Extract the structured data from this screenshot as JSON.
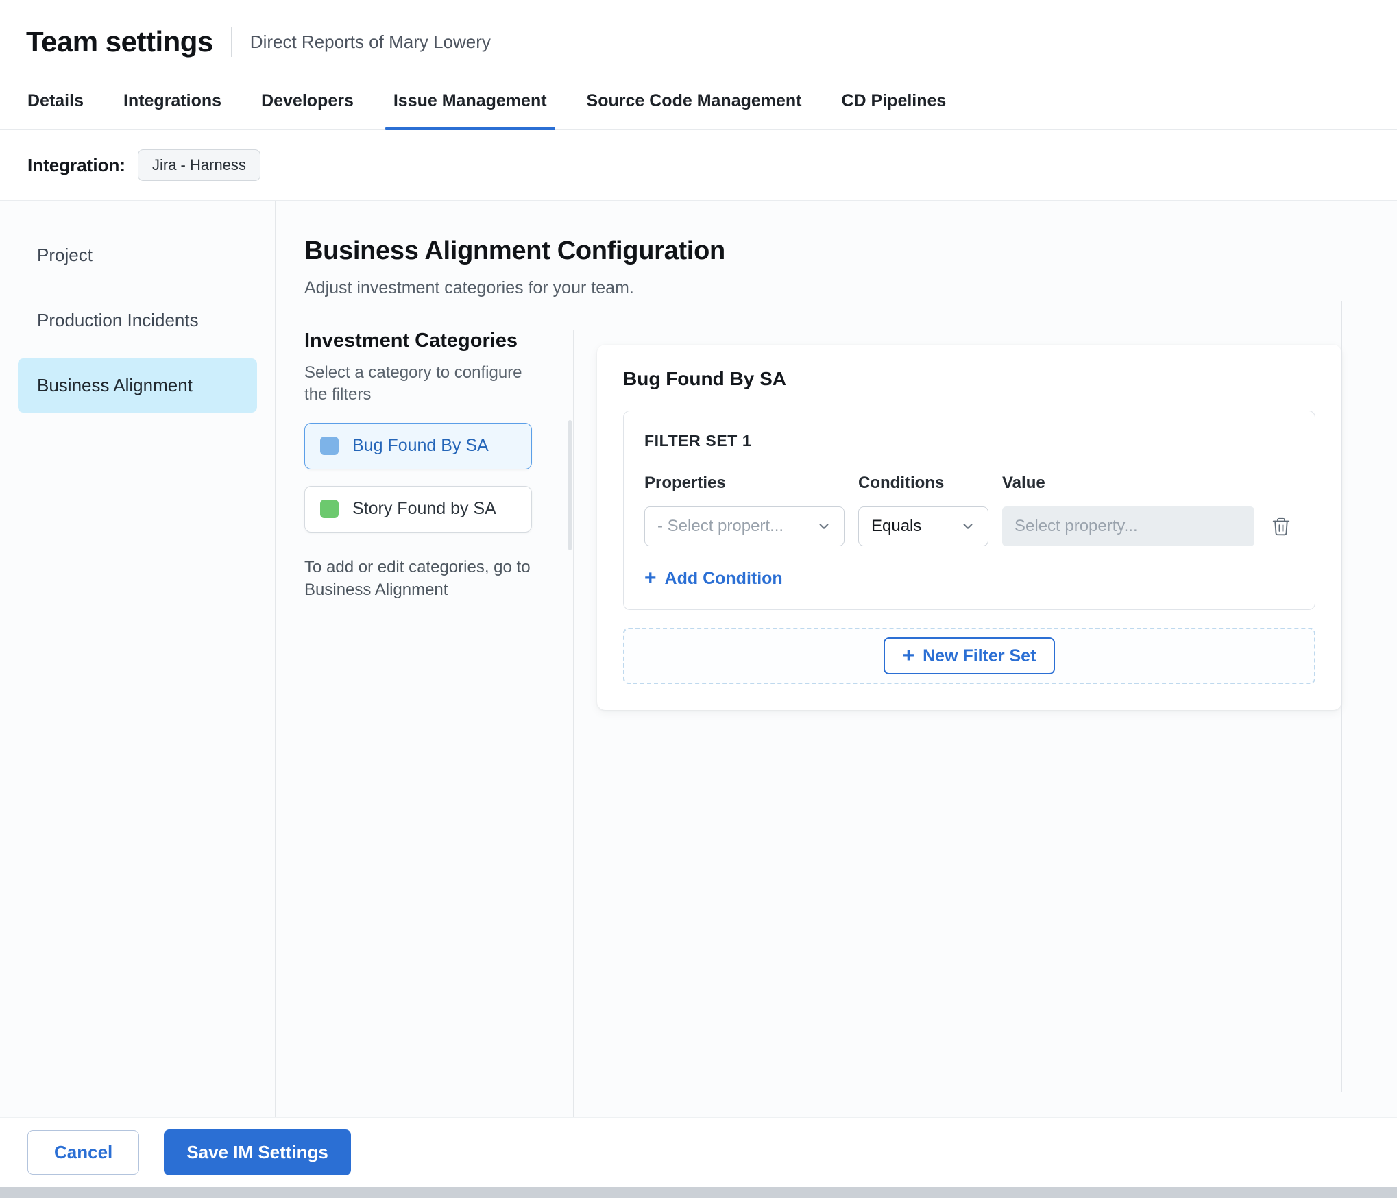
{
  "header": {
    "title": "Team settings",
    "subtitle": "Direct Reports of Mary Lowery"
  },
  "tabs": [
    {
      "label": "Details",
      "active": false
    },
    {
      "label": "Integrations",
      "active": false
    },
    {
      "label": "Developers",
      "active": false
    },
    {
      "label": "Issue Management",
      "active": true
    },
    {
      "label": "Source Code Management",
      "active": false
    },
    {
      "label": "CD Pipelines",
      "active": false
    }
  ],
  "integration": {
    "label": "Integration:",
    "value": "Jira - Harness"
  },
  "sidebar": {
    "items": [
      {
        "label": "Project",
        "active": false
      },
      {
        "label": "Production Incidents",
        "active": false
      },
      {
        "label": "Business Alignment",
        "active": true
      }
    ]
  },
  "main": {
    "title": "Business Alignment Configuration",
    "subtitle": "Adjust investment categories for your team.",
    "investment_categories": {
      "title": "Investment Categories",
      "hint": "Select a category to configure the filters",
      "items": [
        {
          "label": "Bug Found By SA",
          "swatch_color": "#7db3e8",
          "swatch_style": "background:#7db3e8",
          "selected": true
        },
        {
          "label": "Story Found by SA",
          "swatch_color": "#6cc96e",
          "swatch_style": "background:#6cc96e",
          "selected": false
        }
      ],
      "footnote": "To add or edit categories, go to Business Alignment"
    },
    "filter_panel": {
      "title": "Bug Found By SA",
      "filter_set": {
        "title": "FILTER SET 1",
        "columns": {
          "properties": "Properties",
          "conditions": "Conditions",
          "value": "Value"
        },
        "property_select": {
          "placeholder": "- Select propert..."
        },
        "condition_select": {
          "value": "Equals"
        },
        "value_input": {
          "placeholder": "Select property..."
        },
        "add_condition_label": "Add Condition"
      },
      "new_filter_set_label": "New Filter Set"
    }
  },
  "footer": {
    "cancel_label": "Cancel",
    "save_label": "Save IM Settings"
  },
  "colors": {
    "accent_blue": "#2b6fd4",
    "active_nav_bg": "#cdeefc",
    "selected_category_bg": "#eef7fe",
    "selected_category_border": "#5b9fe8",
    "bug_swatch": "#7db3e8",
    "story_swatch": "#6cc96e",
    "disabled_input_bg": "#e9edf0"
  }
}
